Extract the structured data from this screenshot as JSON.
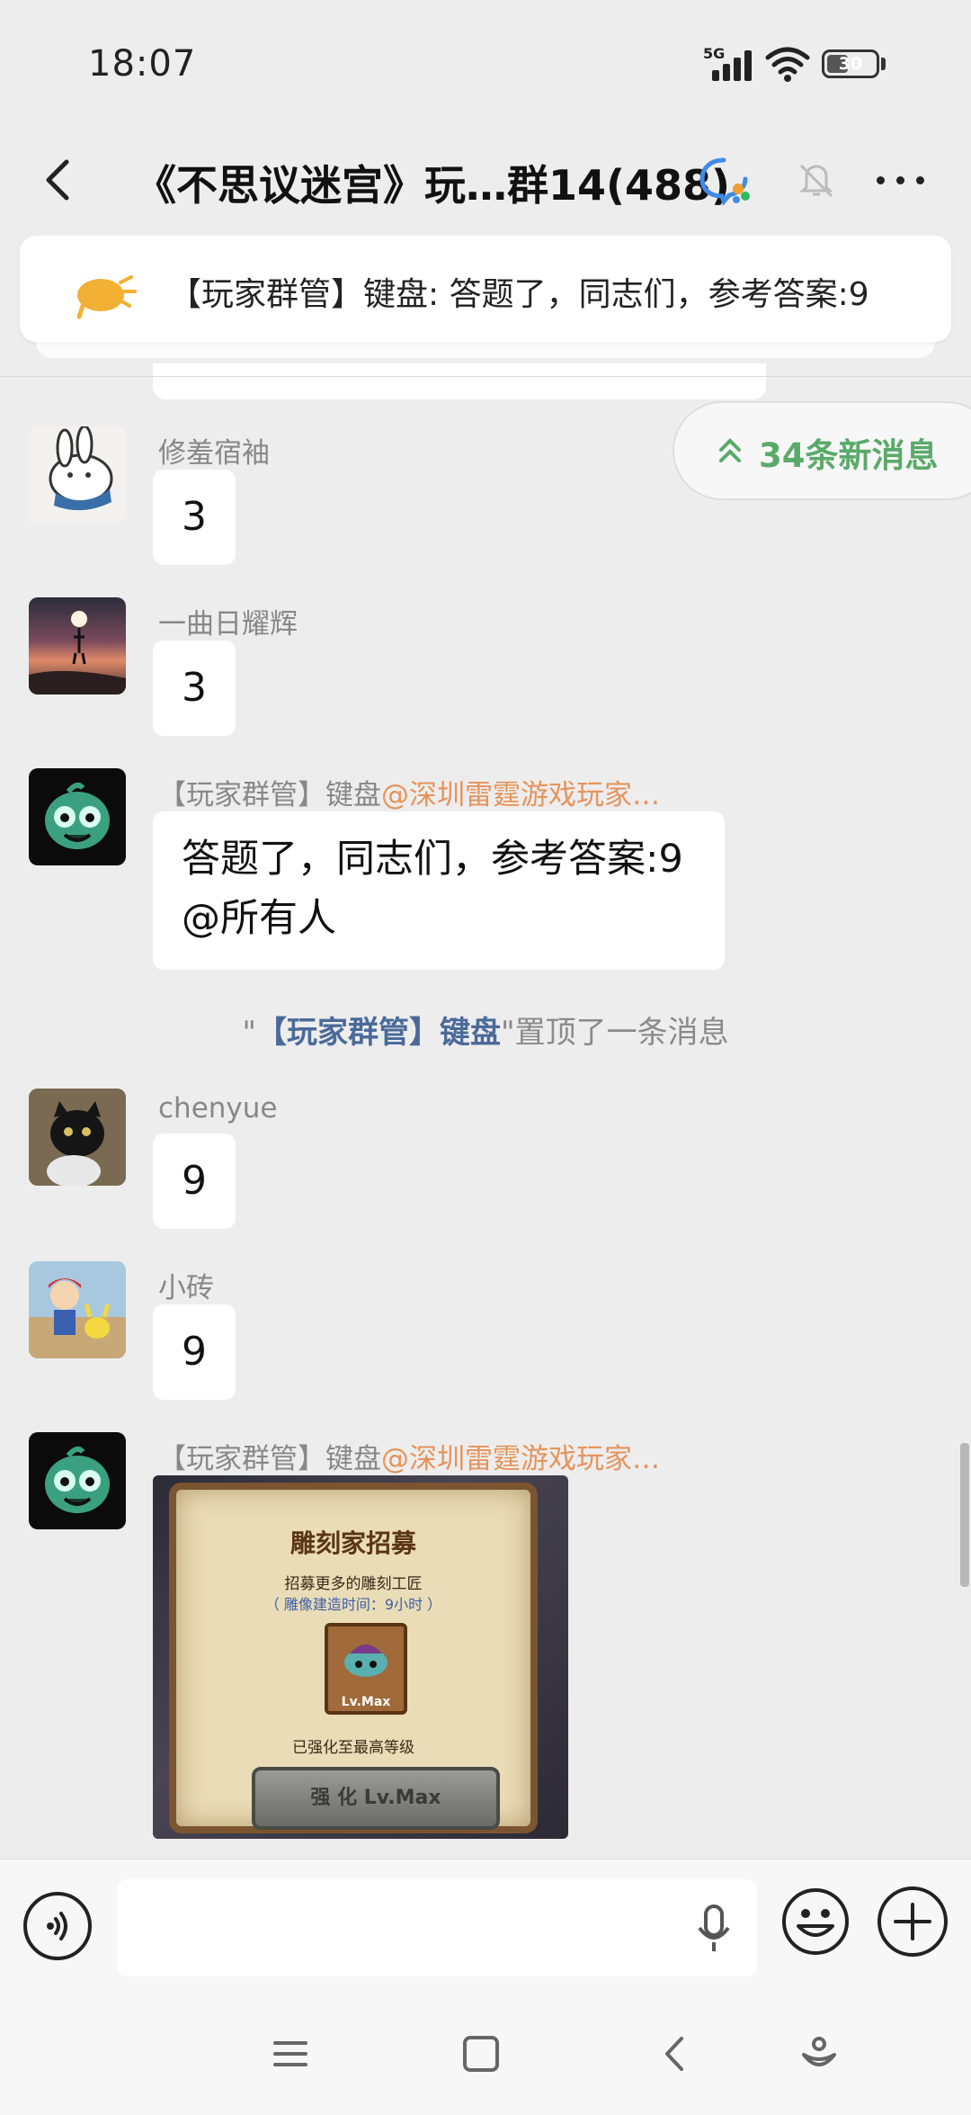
{
  "status_bar": {
    "time": "18:07",
    "network": "5G",
    "battery": "30"
  },
  "header": {
    "title": "《不思议迷宫》玩…群14(488)"
  },
  "pinned": {
    "text": "【玩家群管】键盘: 答题了，同志们，参考答案:9"
  },
  "new_messages": {
    "label": "34条新消息"
  },
  "messages": [
    {
      "sender": "修羞宿袖",
      "text": "3"
    },
    {
      "sender": "一曲日耀辉",
      "text": "3"
    },
    {
      "sender": "【玩家群管】键盘",
      "mention": "@深圳雷霆游戏玩家…",
      "line1": "答题了，同志们，参考答案:9",
      "line2": "@所有人"
    },
    {
      "sender": "chenyue",
      "text": "9"
    },
    {
      "sender": "小砖",
      "text": "9"
    },
    {
      "sender": "【玩家群管】键盘",
      "mention": "@深圳雷霆游戏玩家…"
    }
  ],
  "system_msg": {
    "quote_open": "\"",
    "who": "【玩家群管】键盘",
    "rest": "\"置顶了一条消息"
  },
  "game_image": {
    "title": "雕刻家招募",
    "sub": "招募更多的雕刻工匠",
    "sub2": "（ 雕像建造时间：9小时 ）",
    "level": "Lv.Max",
    "status": "已强化至最高等级",
    "button": "强 化 Lv.Max"
  },
  "input": {
    "value": ""
  },
  "colors": {
    "accent_green": "#5aaa6a",
    "mention": "#e6935b",
    "sys_name": "#4b6a99"
  }
}
